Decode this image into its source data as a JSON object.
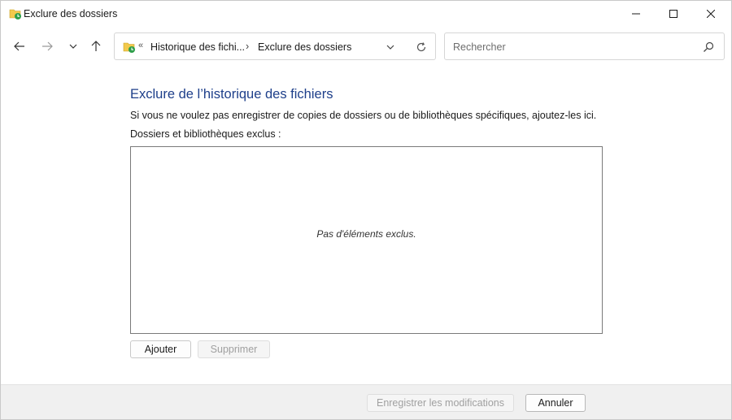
{
  "window": {
    "title": "Exclure des dossiers",
    "app_icon": "file-history-icon",
    "controls": {
      "minimize_icon": "minimize-icon",
      "maximize_icon": "maximize-icon",
      "close_icon": "close-icon"
    }
  },
  "navigation": {
    "back_icon": "arrow-left-icon",
    "forward_icon": "arrow-right-icon",
    "recent_icon": "chevron-down-icon",
    "up_icon": "arrow-up-icon",
    "address": {
      "overflow_glyph": "«",
      "crumbs": [
        "Historique des fichi...",
        "Exclure des dossiers"
      ],
      "separator": "›",
      "dropdown_icon": "chevron-down-icon",
      "refresh_icon": "refresh-icon"
    },
    "search": {
      "placeholder": "Rechercher",
      "value": "",
      "icon": "search-icon"
    }
  },
  "main": {
    "heading": "Exclure de l’historique des fichiers",
    "description": "Si vous ne voulez pas enregistrer de copies de dossiers ou de bibliothèques spécifiques, ajoutez-les ici.",
    "list_label": "Dossiers et bibliothèques exclus :",
    "list_items": [],
    "empty_text": "Pas d'éléments exclus.",
    "add_button": "Ajouter",
    "remove_button": "Supprimer"
  },
  "footer": {
    "save_button": "Enregistrer les modifications",
    "cancel_button": "Annuler"
  },
  "colors": {
    "heading": "#1e3f8a",
    "footer_bg": "#f0f0f0",
    "disabled_text": "#a0a0a0"
  }
}
